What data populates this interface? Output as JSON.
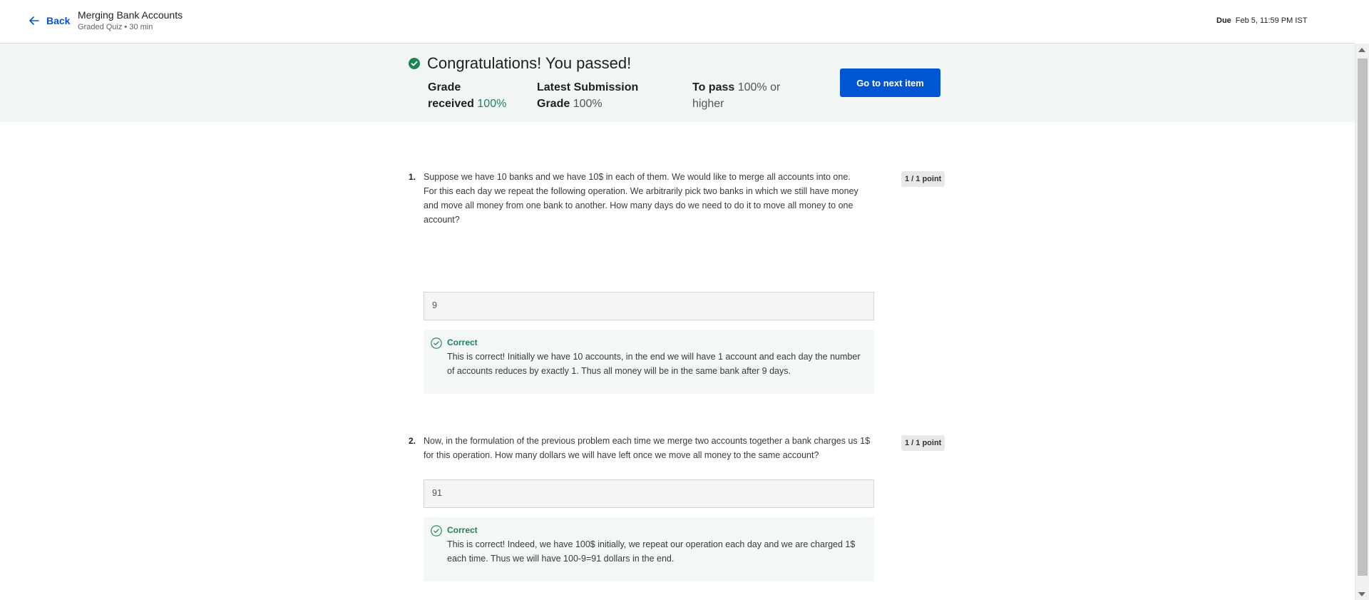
{
  "header": {
    "back_label": "Back",
    "quiz_title": "Merging Bank Accounts",
    "quiz_subtitle": "Graded Quiz • 30 min",
    "due_label": "Due",
    "due_value": "Feb 5, 11:59 PM IST"
  },
  "banner": {
    "congrats": "Congratulations! You passed!",
    "grade_label_1": "Grade",
    "grade_label_2": "received",
    "grade_value": "100%",
    "latest_label_1": "Latest Submission",
    "latest_label_2": "Grade",
    "latest_value": "100%",
    "pass_label": "To pass",
    "pass_value_1": "100% or",
    "pass_value_2": "higher",
    "next_button": "Go to next item"
  },
  "questions": [
    {
      "number": "1.",
      "text": "Suppose we have 10 banks and we have 10$ in each of them. We would like to merge all accounts into one. For this each day we repeat the following operation. We arbitrarily pick two banks in which we still have money and move all money from one bank to another. How many days do we need to do it to move all money to one account?",
      "points": "1 / 1 point",
      "answer": "9",
      "feedback_title": "Correct",
      "feedback_text": "This is correct! Initially we have 10 accounts, in the end we will have 1 account and each day the number of accounts reduces by exactly 1. Thus all money will be in the same bank after 9 days."
    },
    {
      "number": "2.",
      "text": "Now, in the formulation of the previous problem each time we merge two accounts together a bank charges us 1$ for this operation. How many dollars we will have left once we move all money to the same account?",
      "points": "1 / 1 point",
      "answer": "91",
      "feedback_title": "Correct",
      "feedback_text": "This is correct! Indeed, we have 100$ initially, we repeat our operation each day and we are charged 1$ each time. Thus we will have 100-9=91 dollars in the end."
    }
  ],
  "colors": {
    "accent": "#0056d2",
    "success": "#1f8354",
    "banner_bg": "#f1f6f4"
  }
}
